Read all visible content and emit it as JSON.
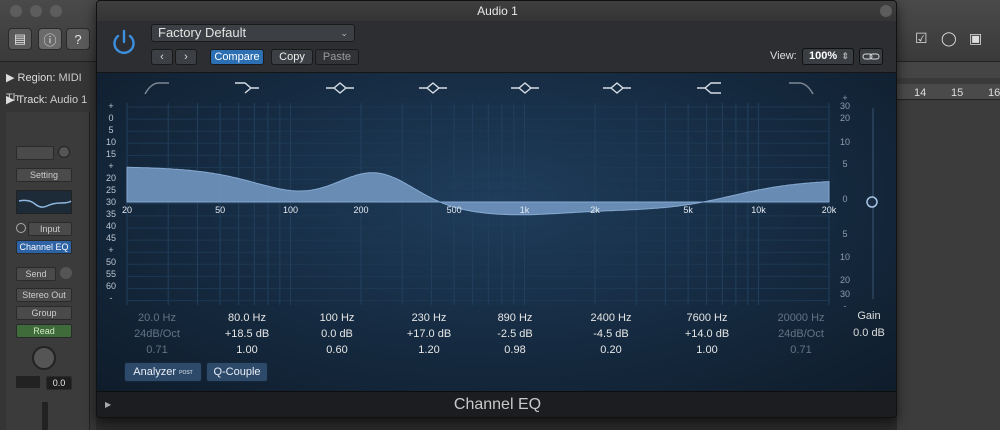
{
  "host": {
    "region_label": "Region:",
    "region_name": "MIDI Th",
    "track_label": "Track:",
    "track_name": "Audio 1",
    "inspector": {
      "setting": "Setting",
      "input": "Input",
      "insert": "Channel EQ",
      "send": "Send",
      "output": "Stereo Out",
      "group": "Group",
      "automation": "Read",
      "volume": "0.0"
    },
    "ruler_numbers": [
      "14",
      "15",
      "16"
    ]
  },
  "plugin": {
    "window_title": "Audio 1",
    "preset": "Factory Default",
    "compare_label": "Compare",
    "copy_label": "Copy",
    "paste_label": "Paste",
    "view_label": "View:",
    "view_value": "100%",
    "footer_title": "Channel EQ",
    "analyzer_label": "Analyzer",
    "analyzer_badge": "POST",
    "qcouple_label": "Q-Couple",
    "gain_label": "Gain",
    "gain_value": "0.0 dB",
    "left_scale": [
      "+",
      "0",
      "5",
      "10",
      "15",
      "+",
      "20",
      "25",
      "30",
      "35",
      "40",
      "45",
      "+",
      "50",
      "55",
      "60",
      "-"
    ],
    "right_scale": [
      "+",
      "30",
      "20",
      "10",
      "5",
      "0",
      "5",
      "10",
      "20",
      "30",
      "-"
    ],
    "freq_labels": [
      "20",
      "50",
      "100",
      "200",
      "500",
      "1k",
      "2k",
      "5k",
      "10k",
      "20k"
    ],
    "bands": [
      {
        "freq": "20.0 Hz",
        "gain": "24dB/Oct",
        "q": "0.71",
        "enabled": false,
        "shape": "high-pass"
      },
      {
        "freq": "80.0 Hz",
        "gain": "+18.5 dB",
        "q": "1.00",
        "enabled": true,
        "shape": "low-shelf"
      },
      {
        "freq": "100 Hz",
        "gain": "0.0 dB",
        "q": "0.60",
        "enabled": true,
        "shape": "bell"
      },
      {
        "freq": "230 Hz",
        "gain": "+17.0 dB",
        "q": "1.20",
        "enabled": true,
        "shape": "bell"
      },
      {
        "freq": "890 Hz",
        "gain": "-2.5 dB",
        "q": "0.98",
        "enabled": true,
        "shape": "bell"
      },
      {
        "freq": "2400 Hz",
        "gain": "-4.5 dB",
        "q": "0.20",
        "enabled": true,
        "shape": "bell"
      },
      {
        "freq": "7600 Hz",
        "gain": "+14.0 dB",
        "q": "1.00",
        "enabled": true,
        "shape": "high-shelf"
      },
      {
        "freq": "20000 Hz",
        "gain": "24dB/Oct",
        "q": "0.71",
        "enabled": false,
        "shape": "low-pass"
      }
    ]
  },
  "colors": {
    "accent": "#3d8fe0",
    "curve_fill": "#6f94bd",
    "eq_bg": "#152a40",
    "button_active": "#2d6fb3"
  }
}
